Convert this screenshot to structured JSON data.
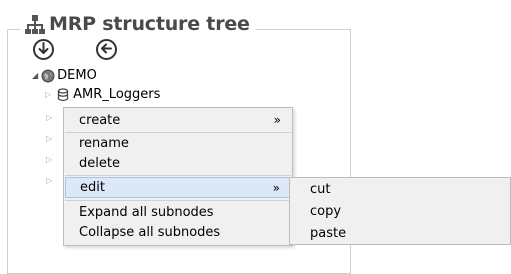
{
  "panel": {
    "title": "MRP structure tree"
  },
  "toolbar": {
    "down_icon": "arrow-down-circle-icon",
    "back_icon": "arrow-left-circle-icon"
  },
  "tree": {
    "root": {
      "label": "DEMO",
      "expanded": true
    },
    "children": [
      {
        "label": "AMR_Loggers"
      }
    ]
  },
  "context_menu": {
    "items": [
      {
        "label": "create",
        "has_submenu": true,
        "arrow": "»"
      },
      {
        "label": "rename"
      },
      {
        "label": "delete"
      },
      {
        "label": "edit",
        "has_submenu": true,
        "arrow": "»",
        "highlighted": true
      },
      {
        "label": "Expand all subnodes"
      },
      {
        "label": "Collapse all subnodes"
      }
    ]
  },
  "edit_submenu": {
    "items": [
      {
        "label": "cut"
      },
      {
        "label": "copy"
      },
      {
        "label": "paste"
      }
    ]
  },
  "colors": {
    "menu_bg": "#f0f0f0",
    "highlight_bg": "#dce8f8",
    "title": "#4a4a4a"
  }
}
